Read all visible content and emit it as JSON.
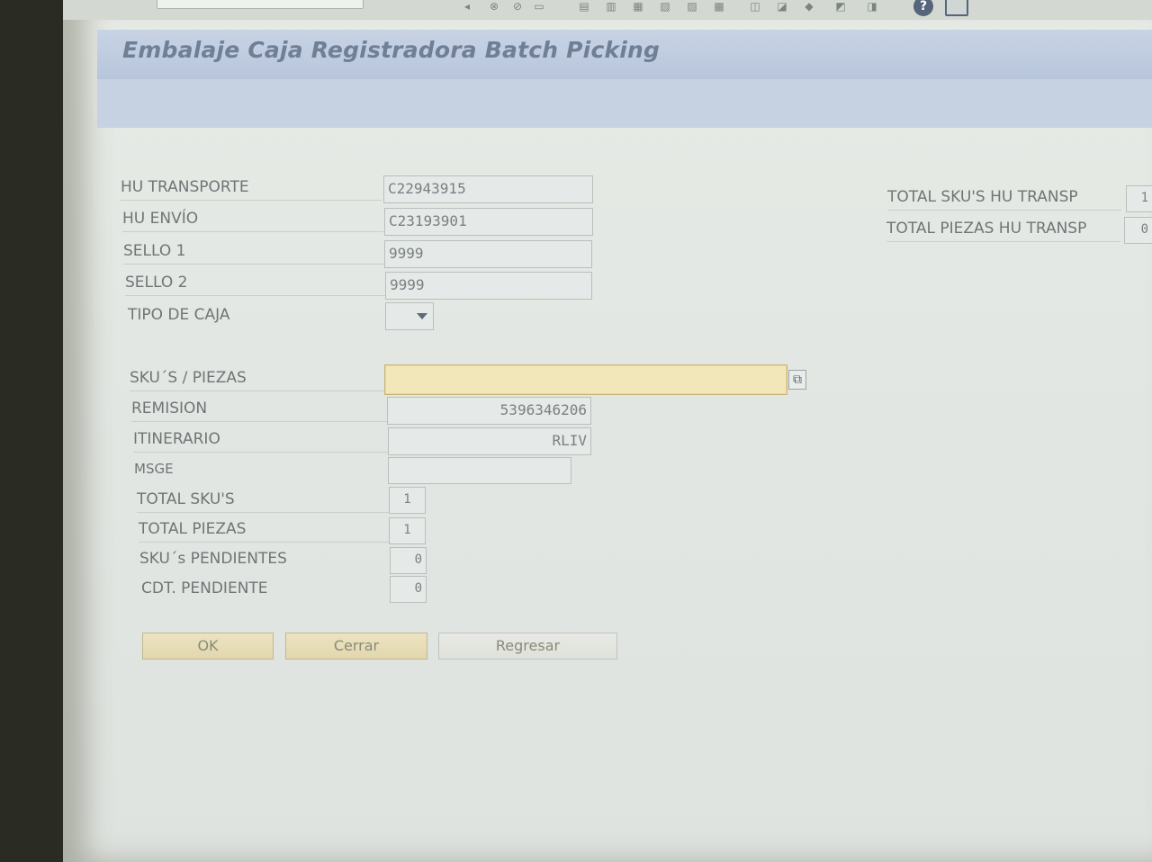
{
  "window": {
    "title": "Embalaje Caja Registradora Batch Picking"
  },
  "toolbar": {
    "help_label": "?"
  },
  "form": {
    "hu_transporte": {
      "label": "HU TRANSPORTE",
      "value": "C22943915"
    },
    "hu_envio": {
      "label": "HU ENVÍO",
      "value": "C23193901"
    },
    "sello1": {
      "label": "SELLO 1",
      "value": "9999"
    },
    "sello2": {
      "label": "SELLO 2",
      "value": "9999"
    },
    "tipo_caja": {
      "label": "TIPO DE CAJA",
      "value": ""
    },
    "skus_piezas": {
      "label": "SKU´S / PIEZAS",
      "value": ""
    },
    "remision": {
      "label": "REMISION",
      "value": "5396346206"
    },
    "itinerario": {
      "label": "ITINERARIO",
      "value": "RLIV"
    },
    "msge": {
      "label": "MSGE",
      "value": ""
    },
    "total_skus": {
      "label": "TOTAL SKU'S",
      "value": "1"
    },
    "total_piezas": {
      "label": "TOTAL PIEZAS",
      "value": "1"
    },
    "skus_pendientes": {
      "label": "SKU´s PENDIENTES",
      "value": "0"
    },
    "cdt_pendiente": {
      "label": "CDT. PENDIENTE",
      "value": "0"
    }
  },
  "summary": {
    "total_skus_hu": {
      "label": "TOTAL SKU'S HU TRANSP",
      "value": "1"
    },
    "total_piezas_hu": {
      "label": "TOTAL PIEZAS HU TRANSP",
      "value": "0"
    }
  },
  "buttons": {
    "ok": "OK",
    "cerrar": "Cerrar",
    "regresar": "Regresar"
  }
}
